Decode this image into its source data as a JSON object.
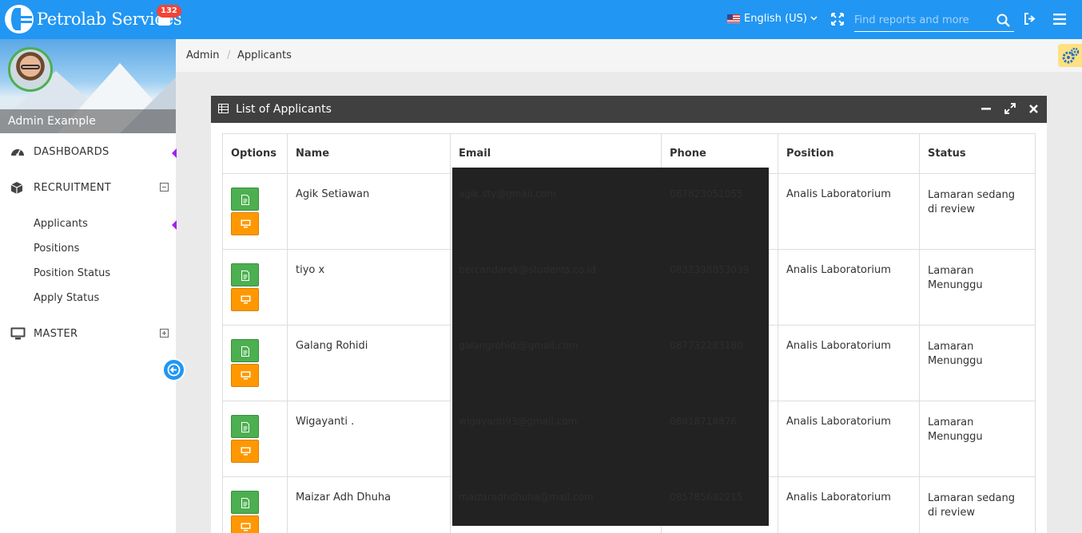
{
  "header": {
    "brand": "Petrolab Services",
    "notification_count": "132",
    "language": "English (US)",
    "search_placeholder": "Find reports and more"
  },
  "sidebar": {
    "user_name": "Admin Example",
    "sections": [
      {
        "label": "DASHBOARDS",
        "icon": "dashboard-icon"
      },
      {
        "label": "RECRUITMENT",
        "icon": "cube-icon",
        "items": [
          "Applicants",
          "Positions",
          "Position Status",
          "Apply Status"
        ]
      },
      {
        "label": "MASTER",
        "icon": "monitor-icon"
      }
    ]
  },
  "breadcrumb": [
    "Admin",
    "Applicants"
  ],
  "panel": {
    "title": "List of Applicants"
  },
  "table": {
    "columns": [
      "Options",
      "Name",
      "Email",
      "Phone",
      "Position",
      "Status"
    ],
    "rows": [
      {
        "name": "Agik Setiawan",
        "email": "agik.sty@gmail.com",
        "phone": "087823051055",
        "position": "Analis Laboratorium",
        "status": "Lamaran sedang di review"
      },
      {
        "name": "tiyo x",
        "email": "bercandarek@students.co.id",
        "phone": "0832398853039",
        "position": "Analis Laboratorium",
        "status": "Lamaran Menunggu"
      },
      {
        "name": "Galang Rohidi",
        "email": "galangrohidi@gmail.com",
        "phone": "087732283180",
        "position": "Analis Laboratorium",
        "status": "Lamaran Menunggu"
      },
      {
        "name": "Wigayanti .",
        "email": "wigayanti93@gmail.com",
        "phone": "08818718876",
        "position": "Analis Laboratorium",
        "status": "Lamaran Menunggu"
      },
      {
        "name": "Maizar Adh Dhuha",
        "email": "maizaradhdhuha@mail.com",
        "phone": "085785682215",
        "position": "Analis Laboratorium",
        "status": "Lamaran sedang di review"
      }
    ]
  },
  "colors": {
    "topbar": "#2196f3",
    "panel_header": "#404040",
    "button_green": "#4caf50",
    "button_orange": "#ff9800",
    "active_marker": "#a020f0"
  }
}
